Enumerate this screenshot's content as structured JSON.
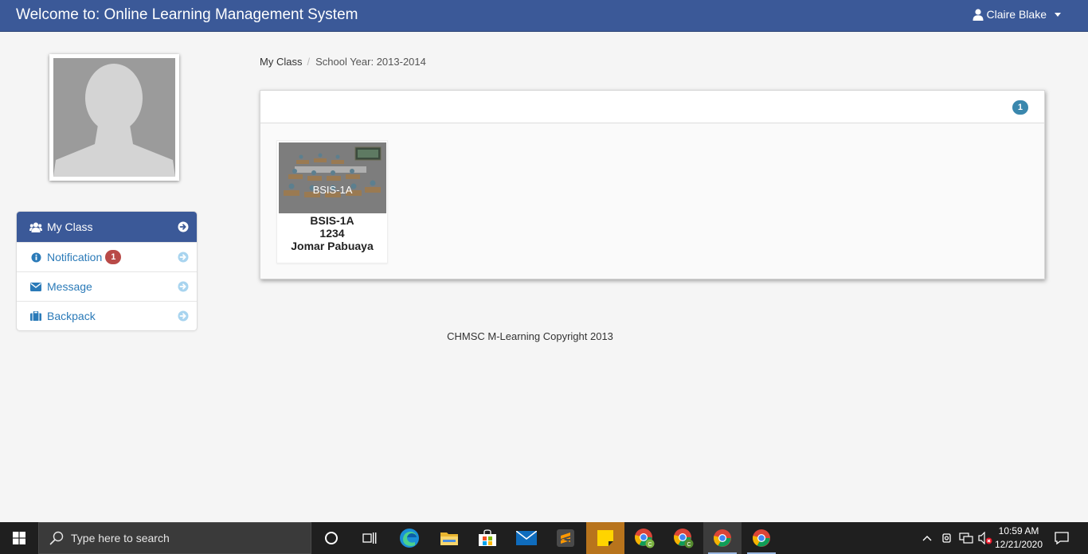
{
  "header": {
    "title": "Welcome to: Online Learning Management System",
    "user_name": "Claire Blake"
  },
  "sidebar": {
    "items": [
      {
        "label": "My Class",
        "icon": "users-icon",
        "active": true
      },
      {
        "label": "Notification",
        "icon": "info-icon",
        "badge": "1"
      },
      {
        "label": "Message",
        "icon": "envelope-icon"
      },
      {
        "label": "Backpack",
        "icon": "briefcase-icon"
      }
    ]
  },
  "breadcrumb": {
    "root": "My Class",
    "separator": "/",
    "current": "School Year: 2013-2014"
  },
  "panel": {
    "count_badge": "1",
    "classes": [
      {
        "thumb_label": "BSIS-1A",
        "name": "BSIS-1A",
        "code": "1234",
        "teacher": "Jomar Pabuaya"
      }
    ]
  },
  "footer": {
    "text": "CHMSC M-Learning Copyright 2013"
  },
  "taskbar": {
    "search_placeholder": "Type here to search",
    "time": "10:59 AM",
    "date": "12/21/2020"
  },
  "colors": {
    "navbar": "#3b5998",
    "link": "#2a7ab8",
    "badge_red": "#b94a48",
    "badge_blue": "#3a87ad"
  }
}
